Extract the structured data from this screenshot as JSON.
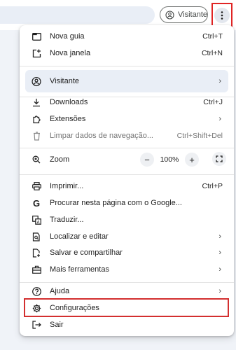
{
  "toolbar": {
    "profile_label": "Visitante"
  },
  "menu": {
    "new_tab": {
      "label": "Nova guia",
      "shortcut": "Ctrl+T"
    },
    "new_window": {
      "label": "Nova janela",
      "shortcut": "Ctrl+N"
    },
    "profile": {
      "label": "Visitante"
    },
    "downloads": {
      "label": "Downloads",
      "shortcut": "Ctrl+J"
    },
    "extensions": {
      "label": "Extensões"
    },
    "clear_data": {
      "label": "Limpar dados de navegação...",
      "shortcut": "Ctrl+Shift+Del"
    },
    "zoom": {
      "label": "Zoom",
      "value": "100%",
      "minus": "−",
      "plus": "+"
    },
    "print": {
      "label": "Imprimir...",
      "shortcut": "Ctrl+P"
    },
    "search_google": {
      "label": "Procurar nesta página com o Google..."
    },
    "translate": {
      "label": "Traduzir..."
    },
    "find_edit": {
      "label": "Localizar e editar"
    },
    "save_share": {
      "label": "Salvar e compartilhar"
    },
    "more_tools": {
      "label": "Mais ferramentas"
    },
    "help": {
      "label": "Ajuda"
    },
    "settings": {
      "label": "Configurações"
    },
    "exit": {
      "label": "Sair"
    }
  },
  "colors": {
    "highlight": "#d32f2f",
    "accent": "#e9eef6"
  }
}
